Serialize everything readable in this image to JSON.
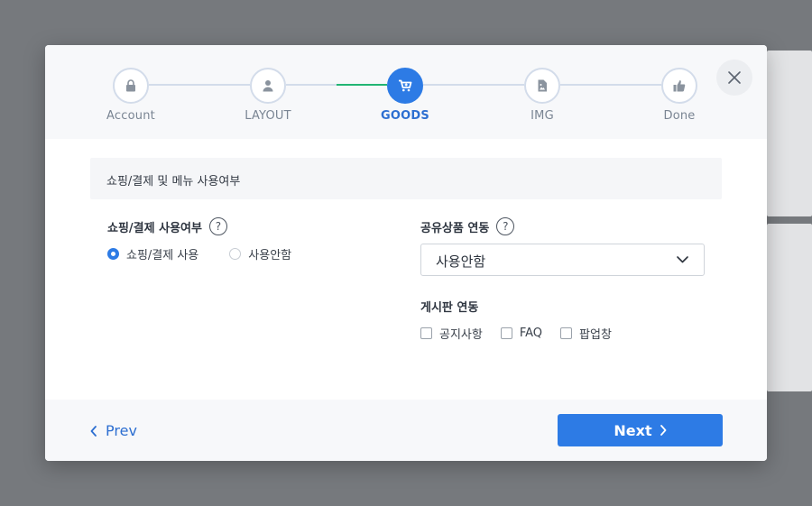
{
  "stepper": {
    "steps": [
      {
        "label": "Account",
        "icon": "lock-icon",
        "state": "done"
      },
      {
        "label": "LAYOUT",
        "icon": "user-icon",
        "state": "done"
      },
      {
        "label": "GOODS",
        "icon": "cart-icon",
        "state": "active"
      },
      {
        "label": "IMG",
        "icon": "image-file-icon",
        "state": "pending"
      },
      {
        "label": "Done",
        "icon": "thumbs-up-icon",
        "state": "pending"
      }
    ],
    "active_color": "#2d7be5",
    "progress_color": "#22b573"
  },
  "section": {
    "title": "쇼핑/결제 및 메뉴 사용여부"
  },
  "shopping": {
    "label": "쇼핑/결제 사용여부",
    "help": "?",
    "options": [
      {
        "label": "쇼핑/결제 사용",
        "checked": true
      },
      {
        "label": "사용안함",
        "checked": false
      }
    ]
  },
  "shared_goods": {
    "label": "공유상품 연동",
    "help": "?",
    "selected": "사용안함"
  },
  "board": {
    "label": "게시판 연동",
    "options": [
      {
        "label": "공지사항",
        "checked": false
      },
      {
        "label": "FAQ",
        "checked": false
      },
      {
        "label": "팝업창",
        "checked": false
      }
    ]
  },
  "footer": {
    "prev_label": "Prev",
    "next_label": "Next"
  }
}
